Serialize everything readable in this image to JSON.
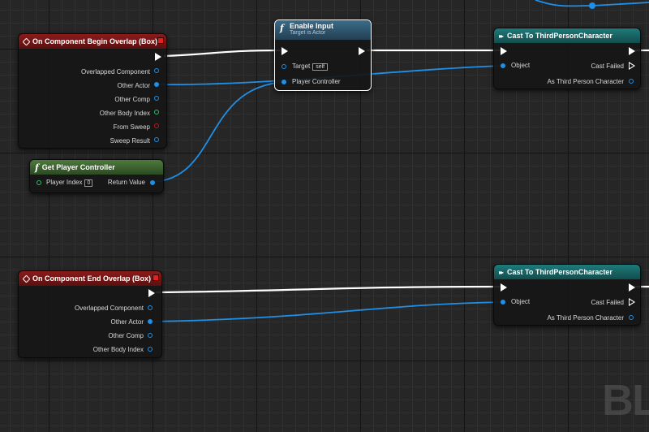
{
  "nodes": {
    "begin_overlap": {
      "title": "On Component Begin Overlap (Box)",
      "pins": [
        "Overlapped Component",
        "Other Actor",
        "Other Comp",
        "Other Body Index",
        "From Sweep",
        "Sweep Result"
      ]
    },
    "enable_input": {
      "title": "Enable Input",
      "subtitle": "Target is Actor",
      "target_label": "Target",
      "target_default": "self",
      "player_controller_label": "Player Controller"
    },
    "cast_1": {
      "title": "Cast To ThirdPersonCharacter",
      "object_label": "Object",
      "cast_failed_label": "Cast Failed",
      "as_label": "As Third Person Character"
    },
    "get_player_controller": {
      "title": "Get Player Controller",
      "player_index_label": "Player Index",
      "player_index_value": "0",
      "return_label": "Return Value"
    },
    "end_overlap": {
      "title": "On Component End Overlap (Box)",
      "pins": [
        "Overlapped Component",
        "Other Actor",
        "Other Comp",
        "Other Body Index"
      ]
    },
    "cast_2": {
      "title": "Cast To ThirdPersonCharacter",
      "object_label": "Object",
      "cast_failed_label": "Cast Failed",
      "as_label": "As Third Person Character"
    }
  },
  "watermark": "BL",
  "colors": {
    "event_header": "#8a1b1b",
    "function_header": "#3a6c8a",
    "pure_header": "#4d7a3c",
    "cast_header": "#1f7a7a",
    "object_pin": "#1e90e8",
    "int_pin": "#27c26b",
    "bool_pin": "#c01818",
    "exec_wire": "#ffffff"
  }
}
